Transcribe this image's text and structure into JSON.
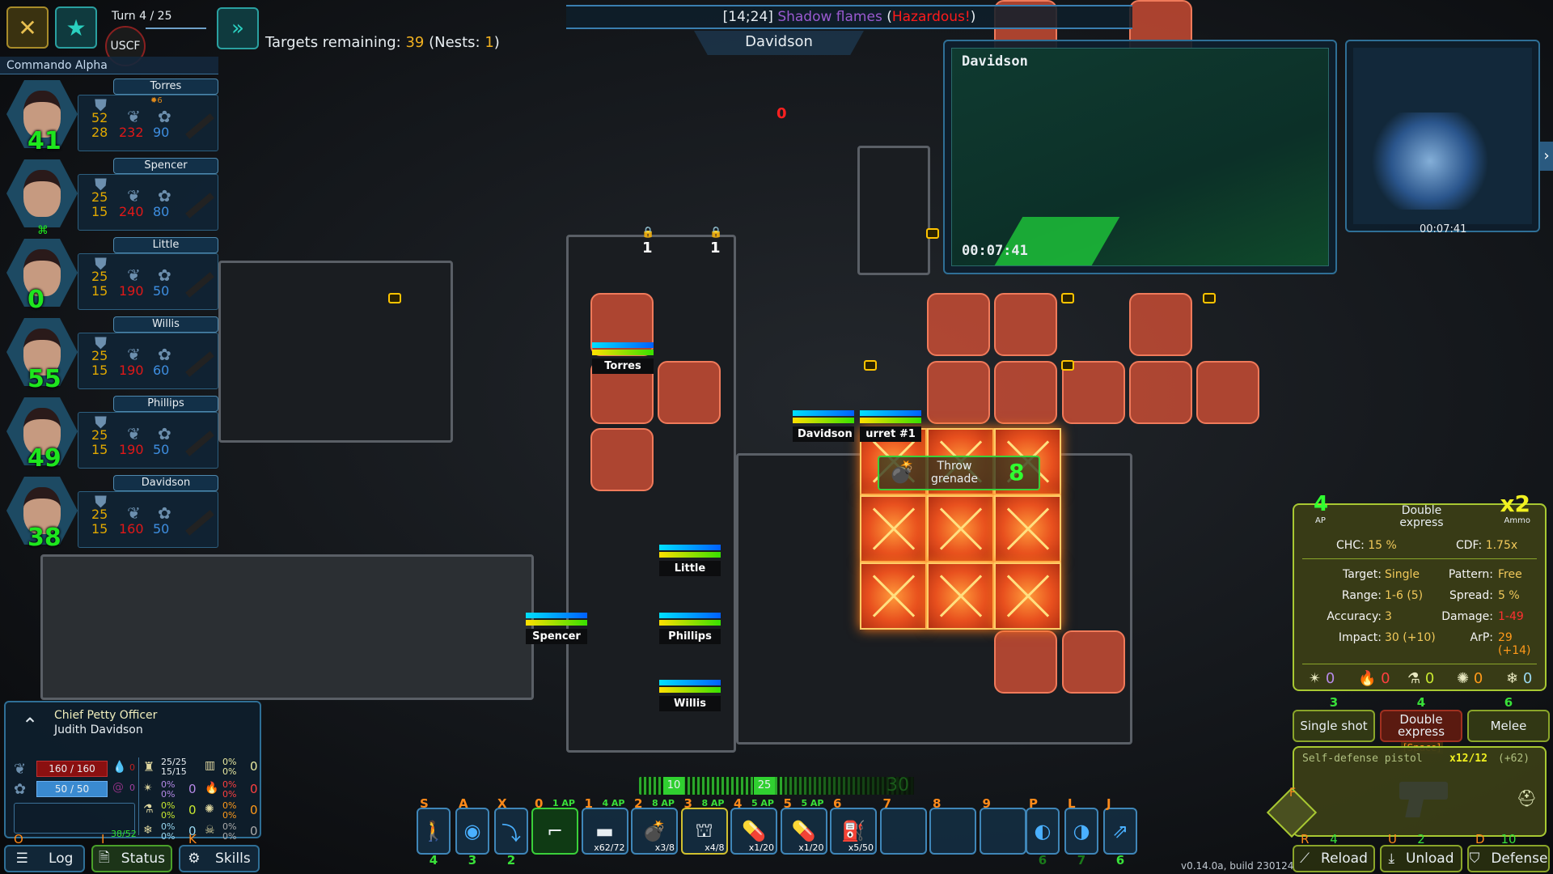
{
  "top": {
    "turn_label": "Turn 4 / 25",
    "faction": "USCF",
    "targets_prefix": "Targets remaining:",
    "targets_count": "39",
    "nests_text": "(Nests:",
    "nests_count": "1",
    "nests_close": ")",
    "tile_coords": "[14;24]",
    "tile_name": "Shadow flames",
    "tile_hazard_open": "(",
    "tile_hazard": "Hazardous!",
    "tile_hazard_close": ")",
    "selected_unit": "Davidson"
  },
  "squad": {
    "name": "Commando Alpha",
    "members": [
      {
        "name": "Torres",
        "armor1": "52",
        "armor2": "28",
        "health": "232",
        "psi": "90",
        "level": "41",
        "status_count": "6"
      },
      {
        "name": "Spencer",
        "armor1": "25",
        "armor2": "15",
        "health": "240",
        "psi": "80",
        "level": ""
      },
      {
        "name": "Little",
        "armor1": "25",
        "armor2": "15",
        "health": "190",
        "psi": "50",
        "level": "0"
      },
      {
        "name": "Willis",
        "armor1": "25",
        "armor2": "15",
        "health": "190",
        "psi": "60",
        "level": "55"
      },
      {
        "name": "Phillips",
        "armor1": "25",
        "armor2": "15",
        "health": "190",
        "psi": "50",
        "level": "49"
      },
      {
        "name": "Davidson",
        "armor1": "25",
        "armor2": "15",
        "health": "160",
        "psi": "50",
        "level": "38"
      }
    ]
  },
  "camera": {
    "unit": "Davidson",
    "time": "00:07:41"
  },
  "minimap": {
    "time": "00:07:41"
  },
  "map": {
    "door_counts": [
      "1",
      "1"
    ],
    "counter": "0",
    "units": [
      "Torres",
      "Little",
      "Phillips",
      "Willis",
      "Spencer",
      "Davidson",
      "urret #1"
    ],
    "action": {
      "label_line1": "Throw",
      "label_line2": "grenade",
      "cost": "8"
    }
  },
  "weapon_panel": {
    "ap": "4",
    "ap_label": "AP",
    "mode": "Double express",
    "ammo": "x2",
    "ammo_label": "Ammo",
    "chc_label": "CHC:",
    "chc": "15 %",
    "cdf_label": "CDF:",
    "cdf": "1.75x",
    "stats": [
      {
        "label": "Target:",
        "value": "Single"
      },
      {
        "label": "Pattern:",
        "value": "Free"
      },
      {
        "label": "Range:",
        "value": "1-6 (5)"
      },
      {
        "label": "Spread:",
        "value": "5 %"
      },
      {
        "label": "Accuracy:",
        "value": "3"
      },
      {
        "label": "Damage:",
        "value": "1-49"
      },
      {
        "label": "Impact:",
        "value": "30 (+10)"
      },
      {
        "label": "ArP:",
        "value": "29 (+14)"
      }
    ],
    "resists": [
      {
        "icon": "shock-icon",
        "value": "0",
        "color": "#b68ae8"
      },
      {
        "icon": "fire-icon",
        "value": "0",
        "color": "#ff4040"
      },
      {
        "icon": "acid-flask-icon",
        "value": "0",
        "color": "#c8e830"
      },
      {
        "icon": "virus-icon",
        "value": "0",
        "color": "#ff9a1a"
      },
      {
        "icon": "frost-icon",
        "value": "0",
        "color": "#9ad8f0"
      }
    ]
  },
  "fire_modes": [
    {
      "label": "Single shot",
      "cost": "3"
    },
    {
      "label": "Double express",
      "cost": "4",
      "hotkey": "[Space]"
    },
    {
      "label": "Melee",
      "cost": "6"
    }
  ],
  "weapon": {
    "name": "Self-defense pistol",
    "ammo": "x12/12",
    "reserve": "(+62)",
    "swap_key": "F"
  },
  "weapon_actions": [
    {
      "label": "Reload",
      "key": "R",
      "cost": "4"
    },
    {
      "label": "Unload",
      "key": "U",
      "cost": "2"
    },
    {
      "label": "Defense",
      "key": "D",
      "cost": "10"
    }
  ],
  "character": {
    "rank": "Chief Petty Officer",
    "name": "Judith Davidson",
    "health": "160 / 160",
    "psi": "50 / 50",
    "bleed": "0",
    "psi_res": "0",
    "armor_a": "25/25",
    "armor_b": "15/15",
    "res": [
      {
        "p1": "0%",
        "p2": "0%",
        "v": "0",
        "c": "#e8e8a0"
      },
      {
        "p1": "0%",
        "p2": "0%",
        "v": "0",
        "c": "#b68ae8"
      },
      {
        "p1": "0%",
        "p2": "0%",
        "v": "0",
        "c": "#ff4040"
      },
      {
        "p1": "0%",
        "p2": "0%",
        "v": "0",
        "c": "#c8e830"
      },
      {
        "p1": "0%",
        "p2": "0%",
        "v": "0",
        "c": "#ff9a1a"
      },
      {
        "p1": "0%",
        "p2": "0%",
        "v": "0",
        "c": "#9ad8f0"
      },
      {
        "p1": "0%",
        "p2": "0%",
        "v": "0",
        "c": "#aaaaaa"
      }
    ],
    "inventory_weight": "38/52"
  },
  "bottom_left": [
    {
      "label": "Log",
      "key": "O"
    },
    {
      "label": "Status",
      "key": "I"
    },
    {
      "label": "Skills",
      "key": "K"
    }
  ],
  "ap_bar": {
    "current": "10",
    "marker": "25",
    "max": "30"
  },
  "hotbar": {
    "stances": [
      {
        "key": "S",
        "value": "4",
        "icon": "walk-icon"
      },
      {
        "key": "A",
        "value": "3",
        "icon": "overwatch-icon"
      },
      {
        "key": "X",
        "value": "2",
        "icon": "crouch-icon"
      }
    ],
    "slots": [
      {
        "key": "0",
        "ap": "1 AP",
        "count": "",
        "icon": "pistol-icon"
      },
      {
        "key": "1",
        "ap": "4 AP",
        "count": "x62/72",
        "icon": "ammo-clip-icon"
      },
      {
        "key": "2",
        "ap": "8 AP",
        "count": "x3/8",
        "icon": "grenade-icon"
      },
      {
        "key": "3",
        "ap": "8 AP",
        "count": "x4/8",
        "icon": "turret-icon"
      },
      {
        "key": "4",
        "ap": "5 AP",
        "count": "x1/20",
        "icon": "pills-blue-icon"
      },
      {
        "key": "5",
        "ap": "5 AP",
        "count": "x1/20",
        "icon": "pills-orange-icon"
      },
      {
        "key": "6",
        "ap": "",
        "count": "x5/50",
        "icon": "fuel-can-icon"
      },
      {
        "key": "7",
        "ap": "",
        "count": ""
      },
      {
        "key": "8",
        "ap": "",
        "count": ""
      },
      {
        "key": "9",
        "ap": "",
        "count": ""
      }
    ],
    "extras": [
      {
        "key": "P",
        "value": "6",
        "icon": "prev-unit-icon"
      },
      {
        "key": "L",
        "value": "7",
        "icon": "next-unit-icon"
      },
      {
        "key": "J",
        "value": "6",
        "icon": "jump-icon"
      }
    ]
  },
  "version": "v0.14.0a, build 230124"
}
